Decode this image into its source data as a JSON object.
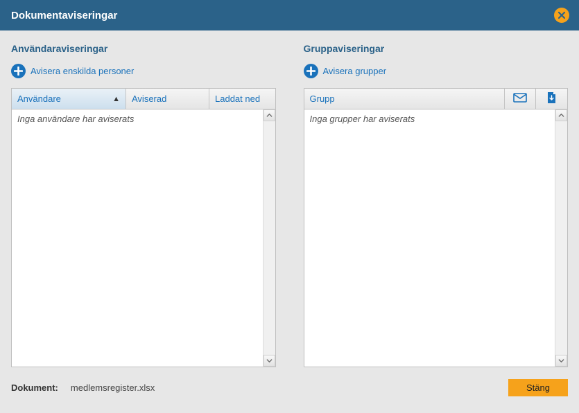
{
  "title": "Dokumentaviseringar",
  "left": {
    "heading": "Användaraviseringar",
    "action_label": "Avisera enskilda personer",
    "columns": {
      "user": "Användare",
      "notified": "Aviserad",
      "downloaded": "Laddat ned"
    },
    "empty_text": "Inga användare har aviserats"
  },
  "right": {
    "heading": "Gruppaviseringar",
    "action_label": "Avisera grupper",
    "columns": {
      "group": "Grupp"
    },
    "empty_text": "Inga grupper har aviserats"
  },
  "footer": {
    "doc_label": "Dokument:",
    "doc_name": "medlemsregister.xlsx",
    "close_label": "Stäng"
  }
}
